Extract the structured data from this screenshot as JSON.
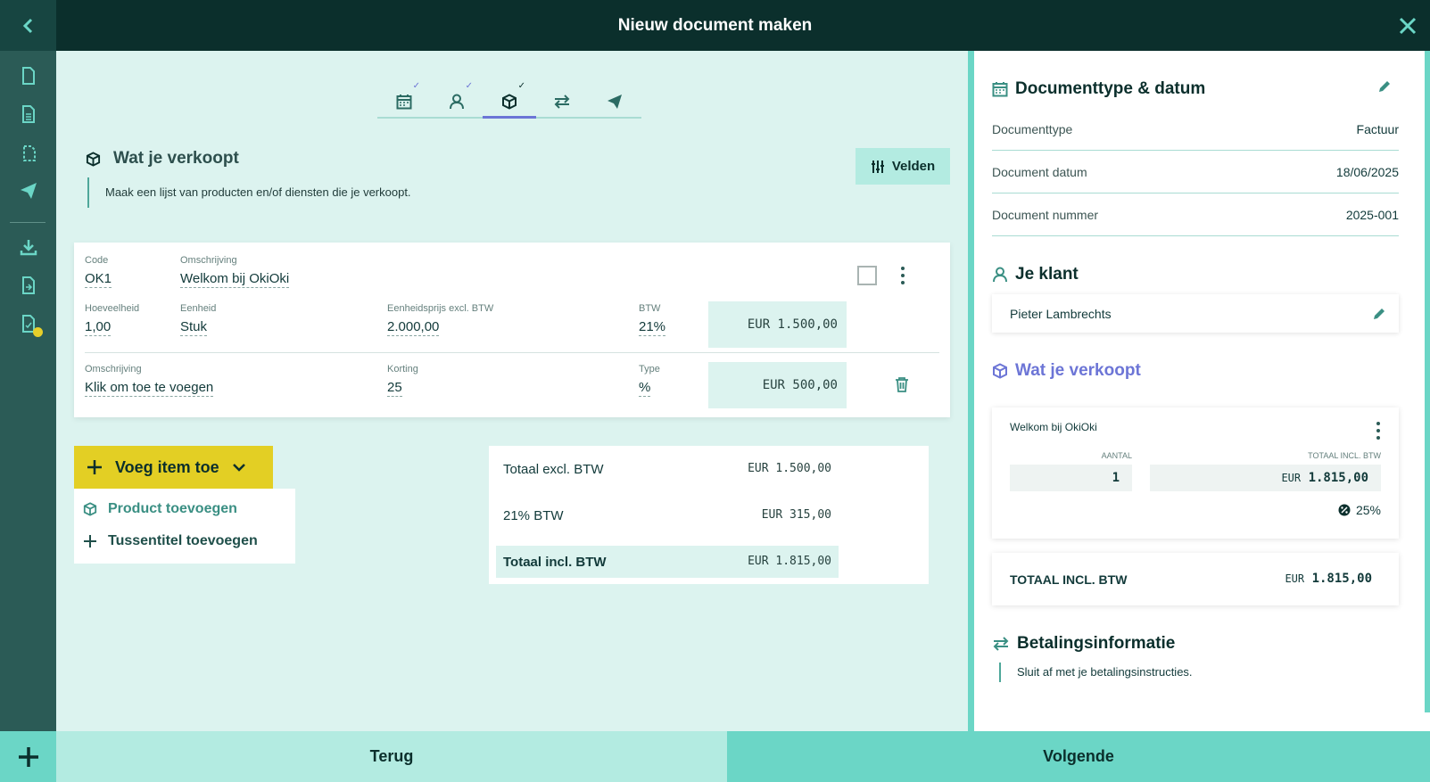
{
  "header": {
    "title": "Nieuw document maken"
  },
  "stepper": {
    "steps": [
      "calendar-icon",
      "person-icon",
      "box-icon",
      "arrows-icon",
      "send-icon"
    ],
    "active": "box-icon"
  },
  "section": {
    "title": "Wat je verkoopt",
    "description": "Maak een lijst van producten en/of diensten die je verkoopt.",
    "fields_button": "Velden"
  },
  "item": {
    "code_label": "Code",
    "code": "OK1",
    "desc_label": "Omschrijving",
    "desc": "Welkom bij OkiOki",
    "qty_label": "Hoeveelheid",
    "qty": "1,00",
    "unit_label": "Eenheid",
    "unit": "Stuk",
    "price_label": "Eenheidsprijs excl. BTW",
    "price": "2.000,00",
    "vat_label": "BTW",
    "vat": "21%",
    "line_total": "EUR 1.500,00",
    "discount_desc_label": "Omschrijving",
    "discount_desc": "Klik om toe te voegen",
    "discount_label": "Korting",
    "discount": "25",
    "type_label": "Type",
    "type": "%",
    "discount_total": "EUR 500,00"
  },
  "actions": {
    "add_item": "Voeg item toe",
    "add_product": "Product toevoegen",
    "add_subtitle": "Tussentitel toevoegen"
  },
  "totals": {
    "excl_label": "Totaal excl. BTW",
    "excl": "EUR 1.500,00",
    "vat_label": "21% BTW",
    "vat": "EUR 315,00",
    "incl_label": "Totaal incl. BTW",
    "incl": "EUR 1.815,00"
  },
  "panel": {
    "doc_title": "Documenttype & datum",
    "rows": [
      {
        "k": "Documenttype",
        "v": "Factuur"
      },
      {
        "k": "Document datum",
        "v": "18/06/2025"
      },
      {
        "k": "Document nummer",
        "v": "2025-001"
      }
    ],
    "client_title": "Je klant",
    "client_name": "Pieter Lambrechts",
    "sell_title": "Wat je verkoopt",
    "product_name": "Welkom bij OkiOki",
    "qty_label": "AANTAL",
    "qty": "1",
    "total_label": "TOTAAL INCL. BTW",
    "total_currency": "EUR",
    "total_amount": "1.815,00",
    "discount_pct": "25%",
    "grand_label": "TOTAAL INCL. BTW",
    "grand_currency": "EUR",
    "grand_amount": "1.815,00",
    "pay_title": "Betalingsinformatie",
    "pay_desc": "Sluit af met je betalingsinstructies."
  },
  "footer": {
    "back": "Terug",
    "next": "Volgende"
  },
  "colors": {
    "dark": "#0b2f2c",
    "accent": "#6bd6c6",
    "purple": "#6c75d6",
    "yellow": "#e3cf24"
  }
}
